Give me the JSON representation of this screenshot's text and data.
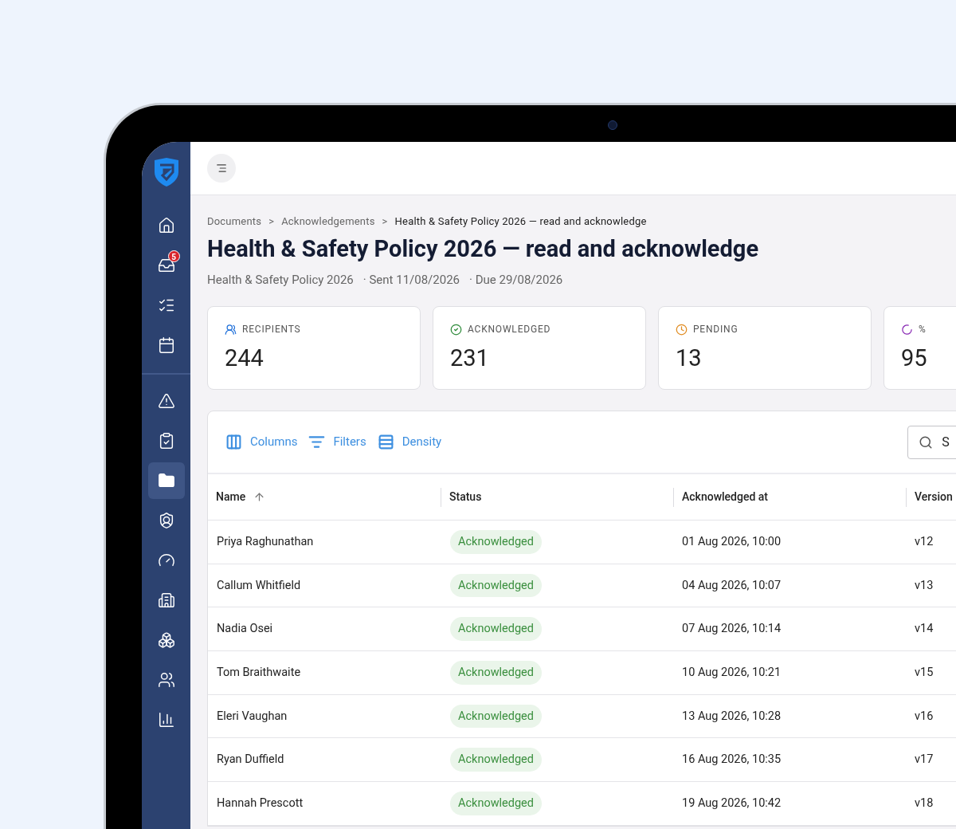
{
  "sidebar": {
    "groups": [
      [
        {
          "selected": false
        },
        {
          "selected": false,
          "badge": "5"
        },
        {
          "selected": false
        },
        {
          "selected": false
        }
      ],
      [
        {
          "selected": false
        },
        {
          "selected": false
        },
        {
          "selected": true
        },
        {
          "selected": false
        },
        {
          "selected": false
        },
        {
          "selected": false
        },
        {
          "selected": false
        },
        {
          "selected": false
        },
        {
          "selected": false
        }
      ]
    ]
  },
  "breadcrumbs": [
    "Documents",
    "Acknowledgements",
    "Health & Safety Policy 2026 — read and acknowledge"
  ],
  "breadcrumb_separator": ">",
  "title": "Health & Safety Policy 2026 — read and acknowledge",
  "meta": [
    "Health & Safety Policy 2026",
    "· Sent 11/08/2026",
    "· Due 29/08/2026"
  ],
  "stats": [
    {
      "kind": "recipients",
      "label": "RECIPIENTS",
      "value": "244"
    },
    {
      "kind": "acknowledged",
      "label": "ACKNOWLEDGED",
      "value": "231"
    },
    {
      "kind": "pending",
      "label": "PENDING",
      "value": "13"
    },
    {
      "kind": "percent",
      "label": "%",
      "value": "95"
    }
  ],
  "toolbar": [
    "Columns",
    "Filters",
    "Density"
  ],
  "search": {
    "placeholder": "S"
  },
  "table": {
    "columns": [
      {
        "label": "Name",
        "sorted": true
      },
      {
        "label": "Status",
        "sorted": false
      },
      {
        "label": "Acknowledged at",
        "sorted": false
      },
      {
        "label": "Version",
        "sorted": false
      }
    ],
    "rows": [
      [
        "Priya Raghunathan",
        "Acknowledged",
        "01 Aug 2026, 10:00",
        "v12"
      ],
      [
        "Callum Whitfield",
        "Acknowledged",
        "04 Aug 2026, 10:07",
        "v13"
      ],
      [
        "Nadia Osei",
        "Acknowledged",
        "07 Aug 2026, 10:14",
        "v14"
      ],
      [
        "Tom Braithwaite",
        "Acknowledged",
        "10 Aug 2026, 10:21",
        "v15"
      ],
      [
        "Eleri Vaughan",
        "Acknowledged",
        "13 Aug 2026, 10:28",
        "v16"
      ],
      [
        "Ryan Duffield",
        "Acknowledged",
        "16 Aug 2026, 10:35",
        "v17"
      ],
      [
        "Hannah Prescott",
        "Acknowledged",
        "19 Aug 2026, 10:42",
        "v18"
      ]
    ]
  }
}
